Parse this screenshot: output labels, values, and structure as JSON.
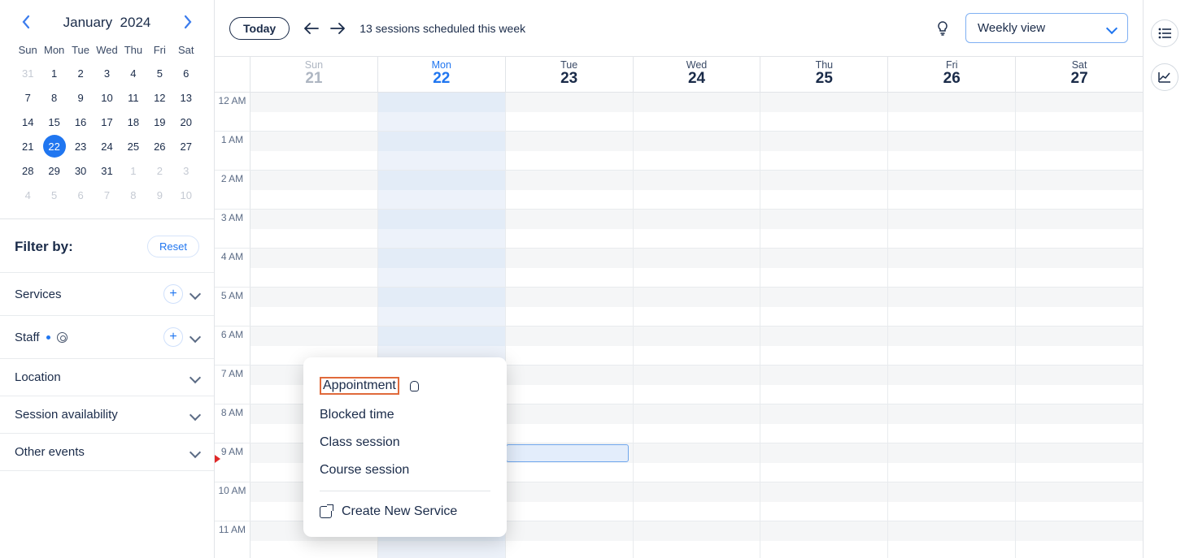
{
  "minical": {
    "month_label": "January",
    "year_label": "2024",
    "dow": [
      "Sun",
      "Mon",
      "Tue",
      "Wed",
      "Thu",
      "Fri",
      "Sat"
    ],
    "weeks": [
      [
        {
          "n": "31",
          "muted": true
        },
        {
          "n": "1"
        },
        {
          "n": "2"
        },
        {
          "n": "3"
        },
        {
          "n": "4"
        },
        {
          "n": "5"
        },
        {
          "n": "6"
        }
      ],
      [
        {
          "n": "7"
        },
        {
          "n": "8"
        },
        {
          "n": "9"
        },
        {
          "n": "10"
        },
        {
          "n": "11"
        },
        {
          "n": "12"
        },
        {
          "n": "13"
        }
      ],
      [
        {
          "n": "14"
        },
        {
          "n": "15"
        },
        {
          "n": "16"
        },
        {
          "n": "17"
        },
        {
          "n": "18"
        },
        {
          "n": "19"
        },
        {
          "n": "20"
        }
      ],
      [
        {
          "n": "21"
        },
        {
          "n": "22",
          "selected": true
        },
        {
          "n": "23"
        },
        {
          "n": "24"
        },
        {
          "n": "25"
        },
        {
          "n": "26"
        },
        {
          "n": "27"
        }
      ],
      [
        {
          "n": "28"
        },
        {
          "n": "29"
        },
        {
          "n": "30"
        },
        {
          "n": "31"
        },
        {
          "n": "1",
          "muted": true
        },
        {
          "n": "2",
          "muted": true
        },
        {
          "n": "3",
          "muted": true
        }
      ],
      [
        {
          "n": "4",
          "muted": true
        },
        {
          "n": "5",
          "muted": true
        },
        {
          "n": "6",
          "muted": true
        },
        {
          "n": "7",
          "muted": true
        },
        {
          "n": "8",
          "muted": true
        },
        {
          "n": "9",
          "muted": true
        },
        {
          "n": "10",
          "muted": true
        }
      ]
    ]
  },
  "filters": {
    "title": "Filter by:",
    "reset": "Reset",
    "services": "Services",
    "staff": "Staff",
    "location": "Location",
    "session_availability": "Session availability",
    "other_events": "Other events"
  },
  "topbar": {
    "today": "Today",
    "sessions_text": "13 sessions scheduled this week",
    "view_label": "Weekly view"
  },
  "days": [
    {
      "dow": "Sun",
      "dom": "21",
      "cls": "muted"
    },
    {
      "dow": "Mon",
      "dom": "22",
      "cls": "today"
    },
    {
      "dow": "Tue",
      "dom": "23",
      "cls": ""
    },
    {
      "dow": "Wed",
      "dom": "24",
      "cls": ""
    },
    {
      "dow": "Thu",
      "dom": "25",
      "cls": ""
    },
    {
      "dow": "Fri",
      "dom": "26",
      "cls": ""
    },
    {
      "dow": "Sat",
      "dom": "27",
      "cls": ""
    }
  ],
  "hours": [
    "12 AM",
    "1 AM",
    "2 AM",
    "3 AM",
    "4 AM",
    "5 AM",
    "6 AM",
    "7 AM",
    "8 AM",
    "9 AM",
    "10 AM",
    "11 AM"
  ],
  "now_row_index": 9,
  "menu": {
    "appointment": "Appointment",
    "blocked_time": "Blocked time",
    "class_session": "Class session",
    "course_session": "Course session",
    "create_new_service": "Create New Service"
  }
}
